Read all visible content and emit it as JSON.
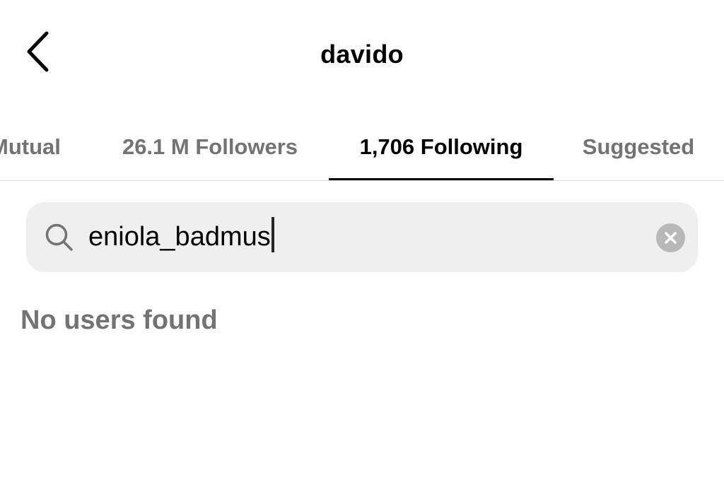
{
  "header": {
    "title": "davido",
    "back_icon": "chevron-left-icon"
  },
  "tabs": [
    {
      "label": "Mutual",
      "active": false
    },
    {
      "label": "26.1 M Followers",
      "active": false
    },
    {
      "label": "1,706 Following",
      "active": true
    },
    {
      "label": "Suggested",
      "active": false
    }
  ],
  "search": {
    "value": "eniola_badmus",
    "search_icon": "search-icon",
    "clear_icon": "clear-icon"
  },
  "results": {
    "empty_message": "No users found"
  },
  "colors": {
    "active_text": "#000000",
    "inactive_text": "#737373",
    "search_background": "#efefef",
    "clear_button": "#b8b8b8",
    "divider": "#dbdbdb"
  }
}
